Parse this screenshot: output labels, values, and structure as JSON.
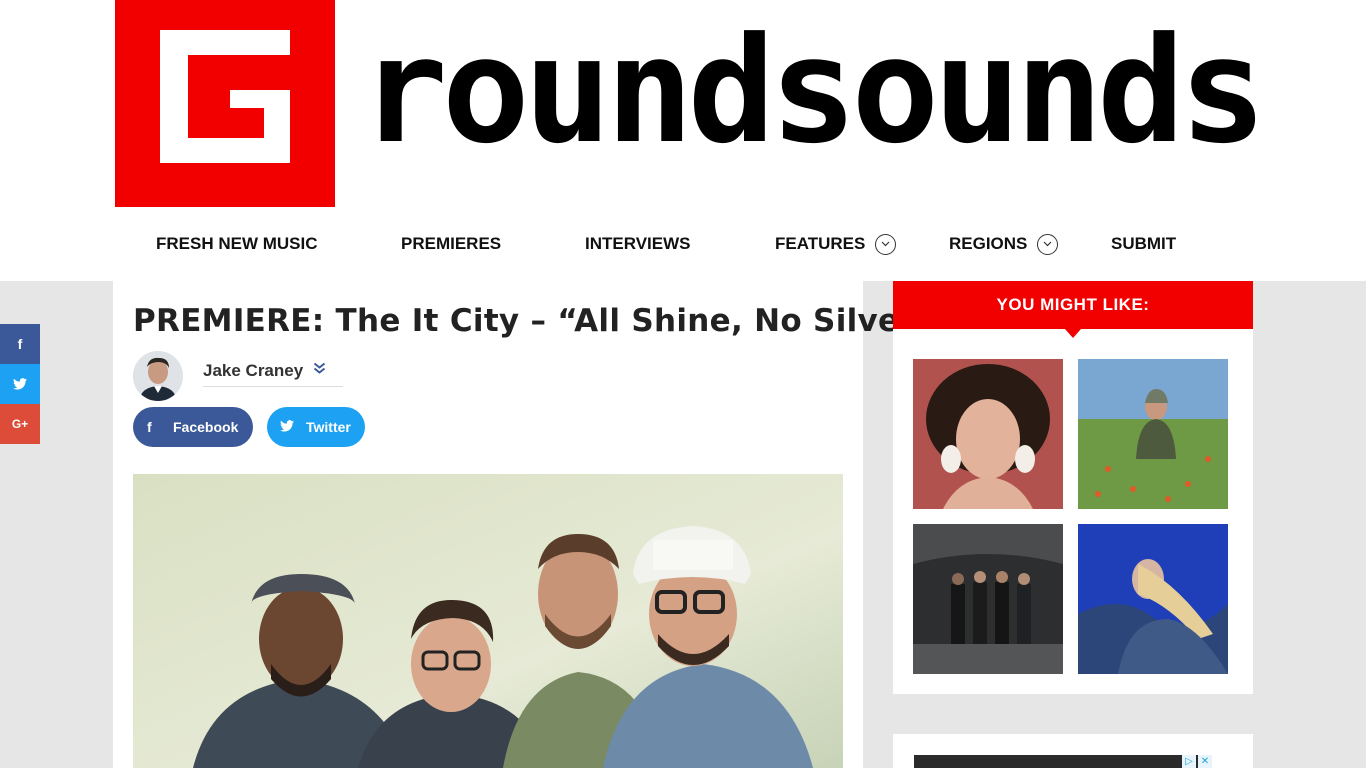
{
  "site": {
    "logo_text": "roundsounds",
    "brand_color": "#f20000"
  },
  "nav": {
    "items": [
      {
        "label": "FRESH NEW MUSIC"
      },
      {
        "label": "PREMIERES"
      },
      {
        "label": "INTERVIEWS"
      },
      {
        "label": "FEATURES",
        "dropdown": true
      },
      {
        "label": "REGIONS",
        "dropdown": true
      },
      {
        "label": "SUBMIT"
      }
    ]
  },
  "floating_share": [
    {
      "network": "facebook",
      "icon": "f",
      "color": "#3b5998"
    },
    {
      "network": "twitter",
      "icon": "twitter-bird-icon",
      "color": "#1da1f2"
    },
    {
      "network": "google-plus",
      "icon": "G+",
      "color": "#dd4b39"
    }
  ],
  "post": {
    "title": "PREMIERE: The It City – “All Shine, No Silver”",
    "author": "Jake Craney",
    "share_facebook": "Facebook",
    "share_twitter": "Twitter"
  },
  "sidebar": {
    "heading": "YOU MIGHT LIKE:"
  }
}
